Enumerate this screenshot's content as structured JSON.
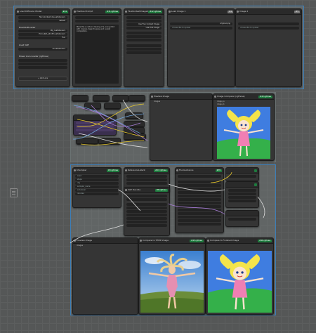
{
  "nodes": {
    "load_diffusion": {
      "title": "Load Diffusion Model",
      "badge": "#24",
      "unet": "flux1-kontext-dev.safetensors",
      "dtype": "default"
    },
    "dual_clip": {
      "title": "DualCLIPLoader",
      "clip1": "clip_l.safetensors",
      "clip2": "t5xxl_fp8_e4m3fn.safetensors",
      "type": "flux",
      "device": "default"
    },
    "load_vae": {
      "title": "Load VAE",
      "vae": "ae.safetensors"
    },
    "power_lora": {
      "title": "Power Lora Loader (rgthree)",
      "add_button": "+ Add Lora"
    },
    "save_prompt": {
      "title": "Positive Prompt",
      "badge": "#31 rgthree",
      "text": "Make this a cartoon drawing of a young child with crayons. Keep the pose and overall composition."
    },
    "scale_image": {
      "title": "FluxKontextImageScale",
      "badge": "#42 rgthree",
      "upscale": "Use Flux Context Image",
      "sizes": "Use First Image"
    },
    "load_image1": {
      "title": "Load Image 1",
      "badge": "#4",
      "image": "original.png",
      "choose": "choose file to upload"
    },
    "load_image2": {
      "title": "Image 2",
      "badge": "#5",
      "choose": "choose file to upload"
    },
    "preview_small": {
      "title": "Preview Image",
      "label": "images"
    },
    "image_compare": {
      "title": "Image Comparer (rgthree)",
      "badge": "#43 rgthree",
      "a": "image_a",
      "b": "image_b"
    },
    "ksampler": {
      "title": "KSampler",
      "badge": "#3 rgthree",
      "seed": "seed",
      "steps": "steps",
      "cfg": "cfg",
      "sampler": "sampler_name",
      "scheduler": "scheduler",
      "denoise": "denoise"
    },
    "ref_latent": {
      "title": "ReferenceLatent",
      "badge": "#27 rgthree"
    },
    "vae_decode": {
      "title": "VAE Decode",
      "badge": "#8 rgthree"
    },
    "flux_guidance": {
      "title": "FluxGuidance",
      "badge": "#35"
    },
    "preview_image": {
      "title": "Preview Image",
      "label": "images"
    },
    "compare_original": {
      "title": "Compare to TEMP image",
      "badge": "#45 rgthree"
    },
    "compare_result": {
      "title": "Compare to Finished Image",
      "badge": "#46 rgthree"
    }
  },
  "colors": {
    "group_border": "#3d7fb8",
    "badge_green": "#1e7a3e",
    "link_yellow": "#e5c62b",
    "link_purple": "#a77cd6",
    "link_blue": "#6fa3d8",
    "link_white": "#dcdcdc"
  }
}
